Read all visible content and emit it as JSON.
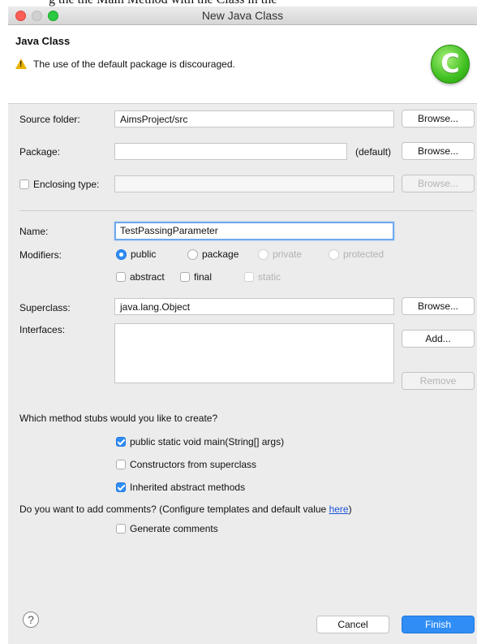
{
  "background_text": "g the the Main Method with the Class in the",
  "window": {
    "title": "New Java Class"
  },
  "header": {
    "title": "Java Class",
    "message": "The use of the default package is discouraged.",
    "logo_letter": "C"
  },
  "form": {
    "source_folder": {
      "label": "Source folder:",
      "value": "AimsProject/src",
      "browse": "Browse..."
    },
    "package": {
      "label": "Package:",
      "value": "",
      "suffix": "(default)",
      "browse": "Browse..."
    },
    "enclosing": {
      "label": "Enclosing type:",
      "value": "",
      "browse": "Browse..."
    },
    "name": {
      "label": "Name:",
      "value": "TestPassingParameter"
    },
    "modifiers": {
      "label": "Modifiers:",
      "public": "public",
      "package": "package",
      "private": "private",
      "protected": "protected",
      "abstract": "abstract",
      "final": "final",
      "static": "static"
    },
    "superclass": {
      "label": "Superclass:",
      "value": "java.lang.Object",
      "browse": "Browse..."
    },
    "interfaces": {
      "label": "Interfaces:",
      "add": "Add...",
      "remove": "Remove"
    }
  },
  "stubs": {
    "question": "Which method stubs would you like to create?",
    "main": "public static void main(String[] args)",
    "constructors": "Constructors from superclass",
    "inherited": "Inherited abstract methods"
  },
  "comments": {
    "question_prefix": "Do you want to add comments? (Configure templates and default value ",
    "link": "here",
    "question_suffix": ")",
    "generate": "Generate comments"
  },
  "footer": {
    "help": "?",
    "cancel": "Cancel",
    "finish": "Finish"
  },
  "colors": {
    "accent": "#2f8df5",
    "warning": "#e8b200",
    "logo": "#3fbf20"
  }
}
